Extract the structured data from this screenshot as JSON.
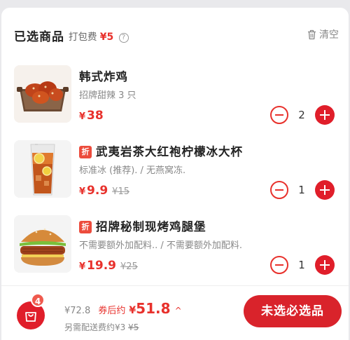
{
  "header": {
    "title": "已选商品",
    "packing_label": "打包费",
    "packing_fee": "¥5",
    "help_glyph": "?",
    "clear_label": "清空",
    "clear_icon": "trash-icon"
  },
  "items": [
    {
      "name": "韩式炸鸡",
      "has_tag": false,
      "spec": "招牌甜辣 3 只",
      "currency": "¥",
      "price": "38",
      "original_price": "",
      "quantity": "2",
      "image": "fried-chicken-image"
    },
    {
      "name": "武夷岩茶大红袍柠檬冰大杯",
      "has_tag": true,
      "tag": "折",
      "spec": "标准冰 (推荐). / 无燕窝冻.",
      "currency": "¥",
      "price": "9.9",
      "original_price": "¥15",
      "quantity": "1",
      "image": "lemon-tea-image"
    },
    {
      "name": "招牌秘制现烤鸡腿堡",
      "has_tag": true,
      "tag": "折",
      "spec": "不需要额外加配料.. / 不需要额外加配料.",
      "currency": "¥",
      "price": "19.9",
      "original_price": "¥25",
      "quantity": "1",
      "image": "chicken-burger-image"
    }
  ],
  "footer": {
    "cart_count": "4",
    "original_total": "¥72.8",
    "after_coupon_label": "券后约",
    "currency": "¥",
    "after_coupon_total": "51.8",
    "caret": "^",
    "delivery_note_prefix": "另需配送费约¥3",
    "delivery_note_strike": "¥5",
    "cta_label": "未选必选品"
  },
  "colors": {
    "accent": "#e8312c",
    "button": "#d9232b",
    "plus": "#e01e2a",
    "tag": "#ec4b3c"
  }
}
